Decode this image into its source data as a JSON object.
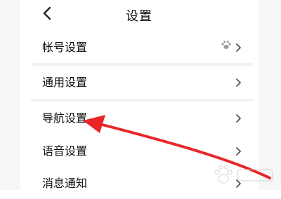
{
  "header": {
    "title": "设置",
    "back_icon": "chevron-left-icon"
  },
  "rows": [
    {
      "label": "帐号设置",
      "icon": "paw-icon",
      "chevron": "chevron-right-icon"
    },
    {
      "label": "通用设置",
      "chevron": "chevron-right-icon"
    },
    {
      "label": "导航设置",
      "chevron": "chevron-right-icon"
    },
    {
      "label": "语音设置",
      "chevron": "chevron-right-icon"
    },
    {
      "label": "消息通知",
      "chevron": "chevron-right-icon"
    }
  ],
  "annotation": {
    "arrow_color": "#e8262a"
  },
  "watermark": {
    "icon": "baidu-paw-logo"
  }
}
